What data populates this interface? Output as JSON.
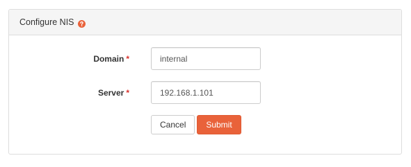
{
  "panel": {
    "title": "Configure NIS",
    "help_icon": "question-circle-icon"
  },
  "form": {
    "domain": {
      "label": "Domain",
      "required_marker": "*",
      "value": "internal"
    },
    "server": {
      "label": "Server",
      "required_marker": "*",
      "value": "192.168.1.101"
    },
    "cancel_label": "Cancel",
    "submit_label": "Submit"
  },
  "colors": {
    "accent": "#e9623a",
    "required": "#d9312b",
    "heading_bg": "#f5f5f5"
  }
}
